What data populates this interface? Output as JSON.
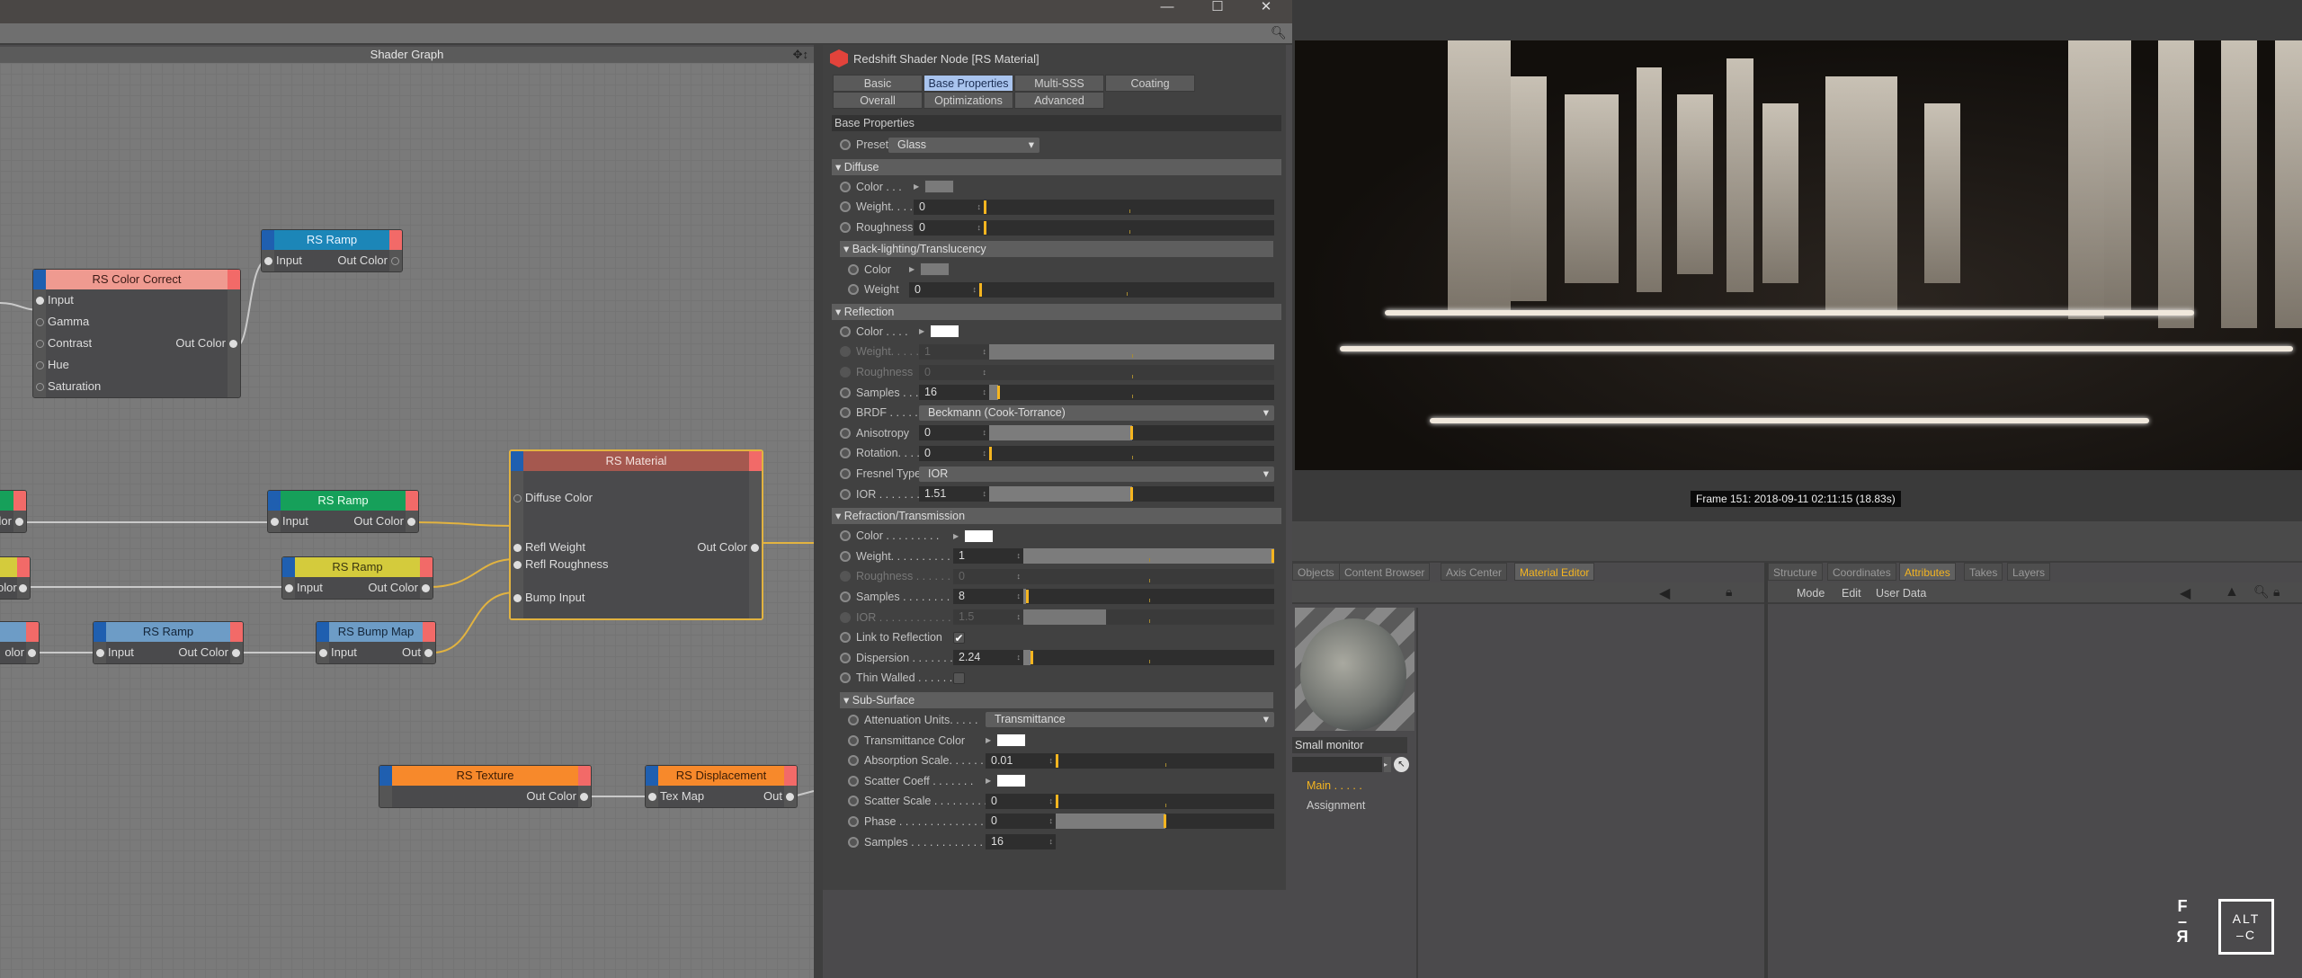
{
  "window": {
    "controls": [
      "—",
      "☐",
      "✕"
    ]
  },
  "shader_graph": {
    "title": "Shader Graph",
    "nodes": [
      {
        "id": "ramp_top",
        "title": "RS Ramp",
        "color": "#1c86b8",
        "text": "#e8f4ff",
        "inputs": [
          "Input"
        ],
        "outputs": [
          "Out Color"
        ]
      },
      {
        "id": "color_correct",
        "title": "RS Color Correct",
        "color": "#ef9a90",
        "text": "#3a1a16",
        "inputs": [
          "Input",
          "Gamma",
          "Contrast",
          "Hue",
          "Saturation"
        ],
        "outputs": [
          "Out Color"
        ]
      },
      {
        "id": "material",
        "title": "RS Material",
        "color": "#a5584f",
        "text": "#f2e2de",
        "inputs": [
          "Diffuse Color",
          "Refl Weight",
          "Refl Roughness",
          "Bump Input"
        ],
        "outputs": [
          "Out Color"
        ]
      },
      {
        "id": "ramp_green",
        "title": "RS Ramp",
        "color": "#16a05a",
        "text": "#eafff0",
        "inputs": [
          "Input"
        ],
        "outputs": [
          "Out Color"
        ]
      },
      {
        "id": "ramp_yellow",
        "title": "RS Ramp",
        "color": "#d4cb3c",
        "text": "#3a3610",
        "inputs": [
          "Input"
        ],
        "outputs": [
          "Out Color"
        ]
      },
      {
        "id": "ramp_lightblue",
        "title": "RS Ramp",
        "color": "#6d9cc6",
        "text": "#14263a",
        "inputs": [
          "Input"
        ],
        "outputs": [
          "Out Color"
        ]
      },
      {
        "id": "bump_map",
        "title": "RS Bump Map",
        "color": "#6d9cc6",
        "text": "#14263a",
        "inputs": [
          "Input"
        ],
        "outputs": [
          "Out"
        ]
      },
      {
        "id": "texture",
        "title": "RS Texture",
        "color": "#f7892b",
        "text": "#3a1c05",
        "inputs": [],
        "outputs": [
          "Out Color"
        ]
      },
      {
        "id": "displacement",
        "title": "RS Displacement",
        "color": "#f7892b",
        "text": "#3a1c05",
        "inputs": [
          "Tex Map"
        ],
        "outputs": [
          "Out"
        ]
      },
      {
        "id": "partial_green",
        "title": "",
        "color": "#16a05a",
        "text": "#fff",
        "inputs": [],
        "outputs": [
          "lor"
        ]
      },
      {
        "id": "partial_yellow",
        "title": "",
        "color": "#d4cb3c",
        "text": "#000",
        "inputs": [],
        "outputs": [
          "olor"
        ]
      },
      {
        "id": "partial_blue",
        "title": "",
        "color": "#6d9cc6",
        "text": "#000",
        "inputs": [],
        "outputs": [
          "olor"
        ]
      }
    ]
  },
  "attributes": {
    "title": "Redshift Shader Node [RS Material]",
    "tabs": [
      {
        "label": "Basic",
        "active": false
      },
      {
        "label": "Base Properties",
        "active": true
      },
      {
        "label": "Multi-SSS",
        "active": false
      },
      {
        "label": "Coating",
        "active": false
      },
      {
        "label": "Overall",
        "active": false
      },
      {
        "label": "Optimizations",
        "active": false
      },
      {
        "label": "Advanced",
        "active": false
      }
    ],
    "group_title": "Base Properties",
    "preset": {
      "label": "Preset",
      "value": "Glass"
    },
    "sections": [
      {
        "title": "Diffuse",
        "sub": false,
        "labelw": 64,
        "rows": [
          {
            "type": "color",
            "label": "Color . . .",
            "color": "#7a7a7a"
          },
          {
            "type": "slider",
            "label": "Weight. . . .",
            "value": "0",
            "fill": 0,
            "thumb": 0
          },
          {
            "type": "slider",
            "label": "Roughness",
            "value": "0",
            "fill": 0,
            "thumb": 0
          }
        ]
      },
      {
        "title": "Back-lighting/Translucency",
        "sub": true,
        "labelw": 50,
        "rows": [
          {
            "type": "color",
            "label": "Color",
            "color": "#7a7a7a"
          },
          {
            "type": "slider",
            "label": "Weight",
            "value": "0",
            "fill": 0,
            "thumb": 0
          }
        ]
      },
      {
        "title": "Reflection",
        "sub": false,
        "labelw": 70,
        "rows": [
          {
            "type": "color",
            "label": "Color . . . .",
            "color": "#ffffff"
          },
          {
            "type": "slider",
            "label": "Weight. . . . .",
            "value": "1",
            "fill": 1,
            "thumb": null,
            "disabled": true
          },
          {
            "type": "slider",
            "label": "Roughness",
            "value": "0",
            "fill": 0,
            "thumb": null,
            "disabled": true
          },
          {
            "type": "slider",
            "label": "Samples . . . .",
            "value": "16",
            "fill": 0.03,
            "thumb": 0.03
          },
          {
            "type": "dropdown",
            "label": "BRDF . . . . . .",
            "value": "Beckmann (Cook-Torrance)"
          },
          {
            "type": "slider",
            "label": "Anisotropy",
            "value": "0",
            "fill": 0.5,
            "thumb": 0.5
          },
          {
            "type": "slider",
            "label": "Rotation. . . .",
            "value": "0",
            "fill": 0,
            "thumb": 0
          },
          {
            "type": "dropdown",
            "label": "Fresnel Type",
            "value": "IOR"
          },
          {
            "type": "slider",
            "label": "IOR . . . . . . . .",
            "value": "1.51",
            "fill": 0.5,
            "thumb": 0.5
          }
        ]
      },
      {
        "title": "Refraction/Transmission",
        "sub": false,
        "labelw": 108,
        "rows": [
          {
            "type": "color",
            "label": "Color . . . . . . . . .",
            "color": "#ffffff"
          },
          {
            "type": "slider",
            "label": "Weight. . . . . . . . . .",
            "value": "1",
            "fill": 1,
            "thumb": 1
          },
          {
            "type": "slider",
            "label": "Roughness . . . . . .",
            "value": "0",
            "fill": 0,
            "thumb": null,
            "disabled": true
          },
          {
            "type": "slider",
            "label": "Samples . . . . . . . . .",
            "value": "8",
            "fill": 0.01,
            "thumb": 0.01
          },
          {
            "type": "slider",
            "label": "IOR . . . . . . . . . . . .",
            "value": "1.5",
            "fill": 0.33,
            "thumb": null,
            "disabled": true
          },
          {
            "type": "checkbox",
            "label": "Link to Reflection",
            "checked": true
          },
          {
            "type": "slider",
            "label": "Dispersion . . . . . . .",
            "value": "2.24",
            "fill": 0.03,
            "thumb": 0.03
          },
          {
            "type": "checkbox",
            "label": "Thin Walled . . . . . .",
            "checked": false
          }
        ]
      },
      {
        "title": "Sub-Surface",
        "sub": true,
        "labelw": 135,
        "rows": [
          {
            "type": "dropdown",
            "label": "Attenuation Units. . . . .",
            "value": "Transmittance"
          },
          {
            "type": "color",
            "label": "Transmittance Color",
            "color": "#ffffff"
          },
          {
            "type": "slider",
            "label": "Absorption Scale. . . . . .",
            "value": "0.01",
            "fill": 0,
            "thumb": 0
          },
          {
            "type": "color",
            "label": "Scatter Coeff . . . . . . .",
            "color": "#ffffff"
          },
          {
            "type": "slider",
            "label": "Scatter Scale . . . . . . . . .",
            "value": "0",
            "fill": 0,
            "thumb": 0
          },
          {
            "type": "slider",
            "label": "Phase . . . . . . . . . . . . . .",
            "value": "0",
            "fill": 0.5,
            "thumb": 0.5
          },
          {
            "type": "number",
            "label": "Samples . . . . . . . . . . . .",
            "value": "16"
          }
        ]
      }
    ]
  },
  "render": {
    "frame_info": "Frame  151:  2018-09-11  02:11:15  (18.83s)"
  },
  "material_panel": {
    "tabs": [
      {
        "label": "Objects",
        "active": false
      },
      {
        "label": "Content Browser",
        "active": false
      },
      {
        "label": "Axis Center",
        "active": false
      },
      {
        "label": "Material Editor",
        "active": true
      }
    ],
    "material_name": "Small monitor",
    "links": [
      {
        "label": "Main . . . . .",
        "active": true
      },
      {
        "label": "Assignment",
        "active": false
      }
    ]
  },
  "attributes_panel": {
    "tabs": [
      {
        "label": "Structure",
        "active": false
      },
      {
        "label": "Coordinates",
        "active": false
      },
      {
        "label": "Attributes",
        "active": true
      },
      {
        "label": "Takes",
        "active": false
      },
      {
        "label": "Layers",
        "active": false
      }
    ],
    "menu": [
      "Mode",
      "Edit",
      "User Data"
    ]
  },
  "logos": {
    "left": "F R",
    "right": "ALT -C"
  }
}
